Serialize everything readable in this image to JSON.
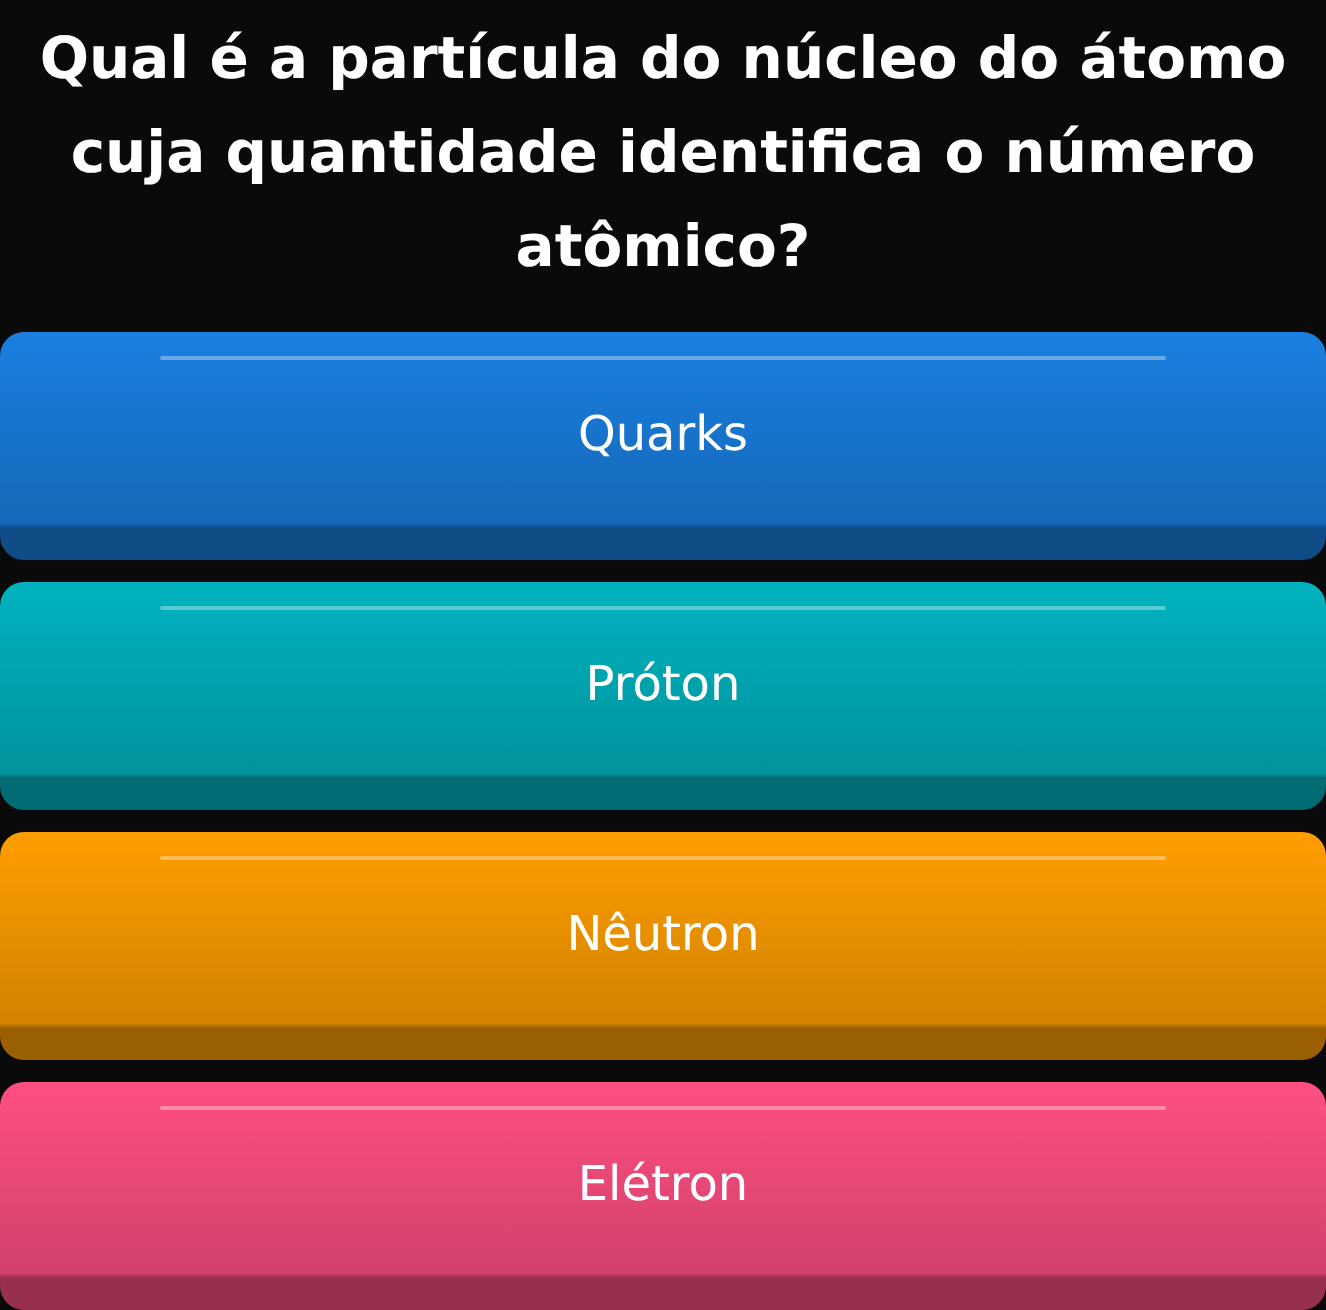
{
  "question": "Qual é a partícula do núcleo do átomo cuja quantidade identifica o número atômico?",
  "options": [
    {
      "label": "Quarks",
      "color": "#1a7fe0"
    },
    {
      "label": "Próton",
      "color": "#00b3bf"
    },
    {
      "label": "Nêutron",
      "color": "#ff9e00"
    },
    {
      "label": "Elétron",
      "color": "#ff4f82"
    }
  ]
}
